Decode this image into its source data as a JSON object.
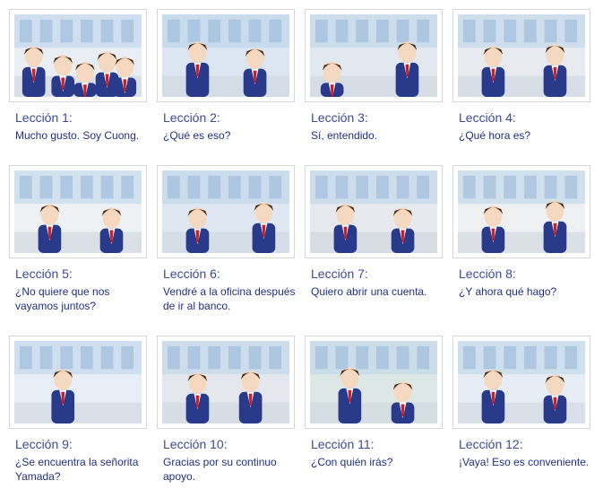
{
  "lessons": [
    {
      "title": "Lección 1:",
      "subtitle": "Mucho gusto. Soy Cuong."
    },
    {
      "title": "Lección 2:",
      "subtitle": "¿Qué es eso?"
    },
    {
      "title": "Lección 3:",
      "subtitle": "Sí, entendido."
    },
    {
      "title": "Lección 4:",
      "subtitle": "¿Qué hora es?"
    },
    {
      "title": "Lección 5:",
      "subtitle": "¿No quiere que nos vayamos juntos?"
    },
    {
      "title": "Lección 6:",
      "subtitle": "Vendré a la oficina después de ir al banco."
    },
    {
      "title": "Lección 7:",
      "subtitle": "Quiero abrir una cuenta."
    },
    {
      "title": "Lección 8:",
      "subtitle": "¿Y ahora qué hago?"
    },
    {
      "title": "Lección 9:",
      "subtitle": "¿Se encuentra la señorita Yamada?"
    },
    {
      "title": "Lección 10:",
      "subtitle": "Gracias por su continuo apoyo."
    },
    {
      "title": "Lección 11:",
      "subtitle": "¿Con quién irás?"
    },
    {
      "title": "Lección 12:",
      "subtitle": "¡Vaya! Eso es conveniente."
    }
  ],
  "colors": {
    "title": "#3a4a9a",
    "subtitle": "#1f2f8a",
    "thumb_border": "#d6d6d6"
  }
}
